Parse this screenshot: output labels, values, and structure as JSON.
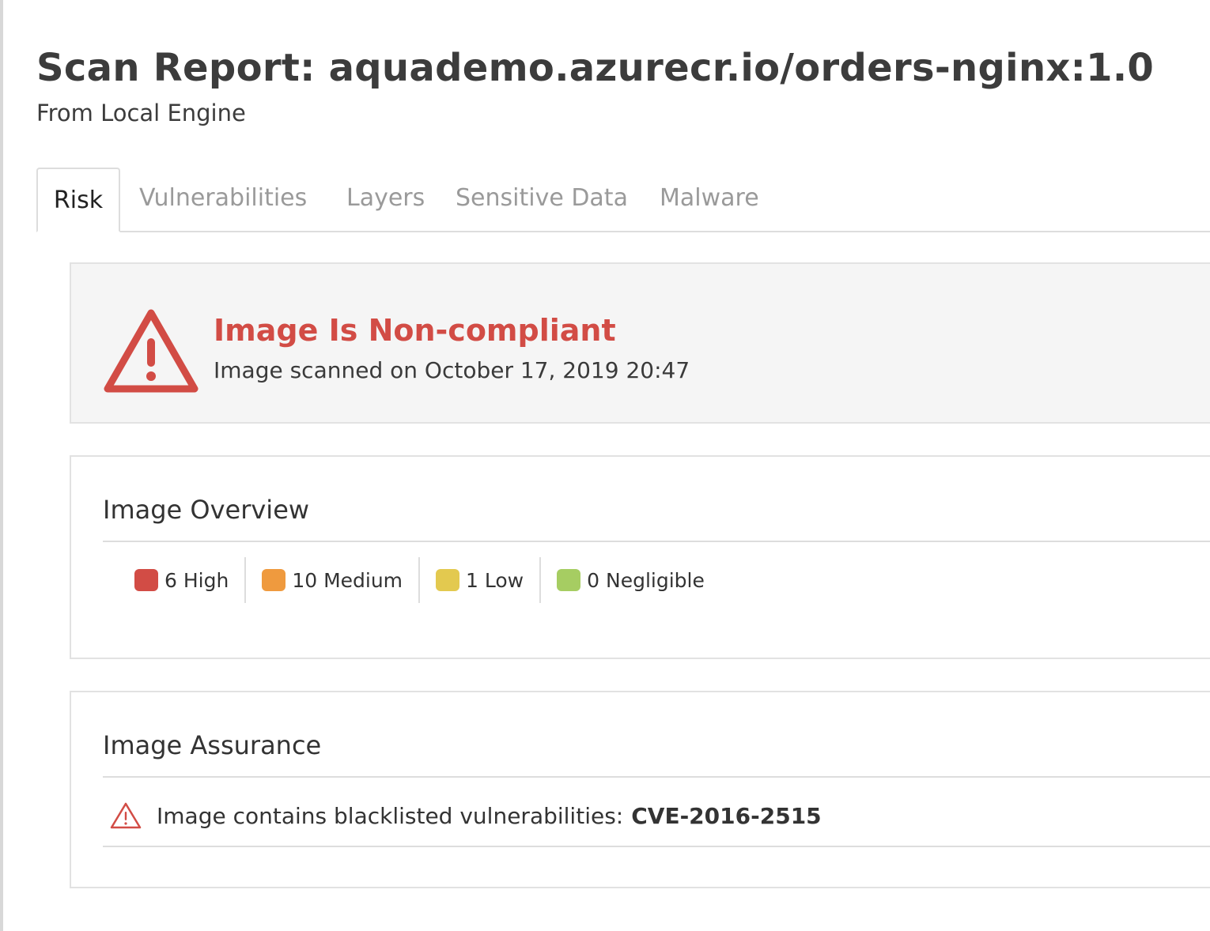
{
  "header": {
    "title": "Scan Report: aquademo.azurecr.io/orders-nginx:1.0",
    "subtitle": "From Local Engine"
  },
  "tabs": [
    {
      "label": "Risk",
      "active": true
    },
    {
      "label": "Vulnerabilities",
      "active": false
    },
    {
      "label": "Layers",
      "active": false
    },
    {
      "label": "Sensitive Data",
      "active": false
    },
    {
      "label": "Malware",
      "active": false
    }
  ],
  "compliance": {
    "icon": "warning-triangle-icon",
    "status": "Image Is Non-compliant",
    "scanned": "Image scanned on October 17, 2019 20:47",
    "color": "#d24c45"
  },
  "overview": {
    "title": "Image Overview",
    "counts": [
      {
        "label": "6 High",
        "color": "#d24c45"
      },
      {
        "label": "10 Medium",
        "color": "#ef9a3e"
      },
      {
        "label": "1 Low",
        "color": "#e3c94f"
      },
      {
        "label": "0 Negligible",
        "color": "#a6cd62"
      }
    ]
  },
  "assurance": {
    "title": "Image Assurance",
    "icon": "warning-outline-icon",
    "message": "Image contains blacklisted vulnerabilities:",
    "cve": "CVE-2016-2515"
  }
}
